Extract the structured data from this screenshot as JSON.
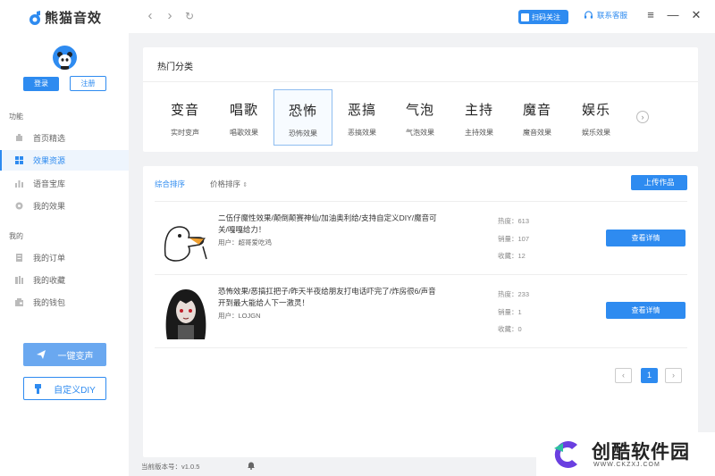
{
  "app": {
    "title": "熊猫音效"
  },
  "header": {
    "follow_label": "扫码关注",
    "service_label": "联系客服"
  },
  "sidebar": {
    "login_label": "登录",
    "register_label": "注册",
    "group_function": "功能",
    "group_mine": "我的",
    "items": [
      {
        "label": "首页精选",
        "icon": "home-icon"
      },
      {
        "label": "效果资源",
        "icon": "grid-icon"
      },
      {
        "label": "语音宝库",
        "icon": "bar-chart-icon"
      },
      {
        "label": "我的效果",
        "icon": "circle-icon"
      },
      {
        "label": "我的订单",
        "icon": "order-icon"
      },
      {
        "label": "我的收藏",
        "icon": "collect-icon"
      },
      {
        "label": "我的钱包",
        "icon": "wallet-icon"
      }
    ],
    "voice_change_label": "一键变声",
    "diy_label": "自定义DIY",
    "version": "当前版本号：v1.0.5"
  },
  "hot": {
    "title": "热门分类",
    "categories": [
      {
        "name": "变音",
        "sub": "实时变声"
      },
      {
        "name": "唱歌",
        "sub": "唱歌效果"
      },
      {
        "name": "恐怖",
        "sub": "恐怖效果"
      },
      {
        "name": "恶搞",
        "sub": "恶搞效果"
      },
      {
        "name": "气泡",
        "sub": "气泡效果"
      },
      {
        "name": "主持",
        "sub": "主持效果"
      },
      {
        "name": "魔音",
        "sub": "魔音效果"
      },
      {
        "name": "娱乐",
        "sub": "娱乐效果"
      }
    ]
  },
  "list": {
    "sort_comprehensive": "综合排序",
    "sort_price": "价格排序",
    "upload_label": "上传作品",
    "detail_label": "查看详情",
    "items": [
      {
        "title": "二伍仔魔性效果/颠倒颠赛神仙/加油奥利给/支持自定义DIY/魔音可关/嘎嘎给力！",
        "user": "用户：超哥爱吃鸡",
        "heat": "热度：613",
        "sales": "销量：107",
        "fav": "收藏：12"
      },
      {
        "title": "恐怖效果/恶搞扛把子/昨天半夜给朋友打电话吓完了/炸房很6/声音开到最大能给人下一激灵！",
        "user": "用户：LOJGN",
        "heat": "热度：233",
        "sales": "销量：1",
        "fav": "收藏：0"
      }
    ],
    "page_current": "1"
  },
  "watermark": {
    "name": "创酷软件园",
    "url": "WWW.CKZXJ.COM"
  },
  "colors": {
    "accent": "#2e8bf0"
  }
}
